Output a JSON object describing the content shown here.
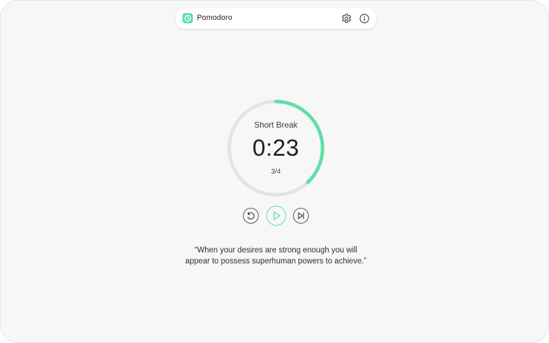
{
  "app": {
    "title": "Pomodoro",
    "accent_color": "#5fe0a8",
    "icon": "pomodoro-logo-icon"
  },
  "header": {
    "settings_icon": "gear-icon",
    "info_icon": "info-icon"
  },
  "timer": {
    "mode_label": "Short Break",
    "time": "0:23",
    "session": "3/4",
    "progress_fraction": 0.38
  },
  "controls": {
    "reset_icon": "reset-icon",
    "play_icon": "play-icon",
    "skip_icon": "skip-next-icon"
  },
  "quote": {
    "line1": "“When your desires are strong enough you will",
    "line2": "appear to possess superhuman powers to achieve.”"
  }
}
